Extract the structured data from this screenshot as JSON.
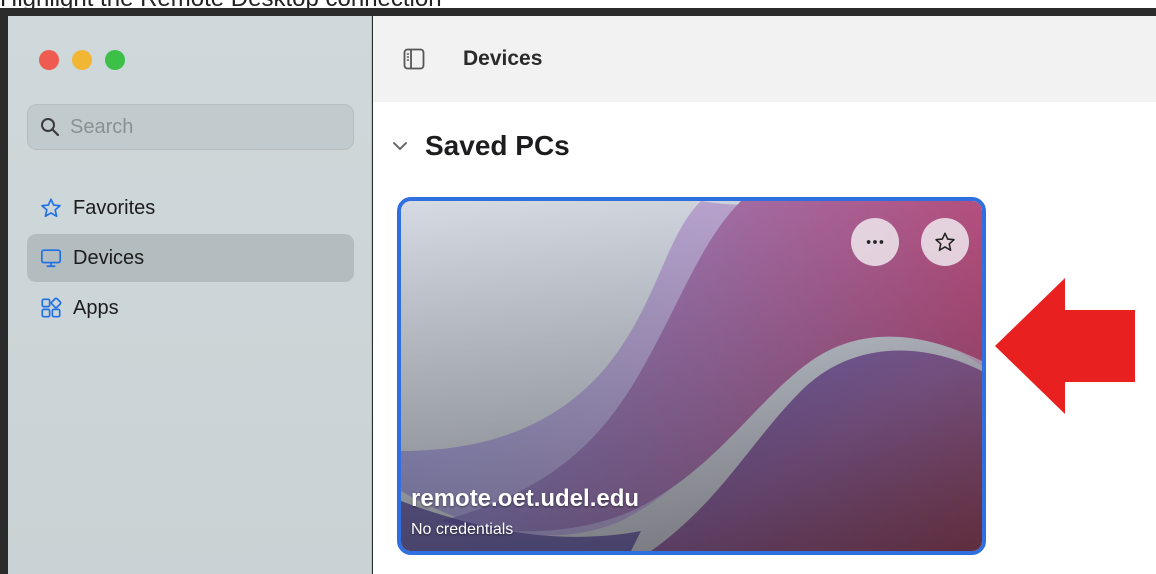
{
  "caption": "Highlight the Remote Desktop connection",
  "window": {
    "controls": [
      "close",
      "minimize",
      "zoom"
    ]
  },
  "sidebar": {
    "search": {
      "placeholder": "Search",
      "icon": "search-icon"
    },
    "items": [
      {
        "label": "Favorites",
        "icon": "star-icon",
        "active": false
      },
      {
        "label": "Devices",
        "icon": "monitor-icon",
        "active": true
      },
      {
        "label": "Apps",
        "icon": "apps-grid-icon",
        "active": false
      }
    ]
  },
  "toolbar": {
    "title": "Devices",
    "sidebar_toggle_icon": "sidebar-toggle-icon"
  },
  "section": {
    "label": "Saved PCs",
    "icon": "chevron-down-icon"
  },
  "pc_card": {
    "hostname": "remote.oet.udel.edu",
    "status": "No credentials",
    "more_icon": "ellipsis-icon",
    "favorite_icon": "star-icon",
    "selected": true
  },
  "annotation": {
    "icon": "red-arrow-left-icon",
    "color": "#e8201f"
  },
  "colors": {
    "accent": "#2f6fe0",
    "sidebar_bg": "#cdd6d8",
    "active_item_bg": "#b3bcbe",
    "icon_blue": "#1f6fe5"
  }
}
